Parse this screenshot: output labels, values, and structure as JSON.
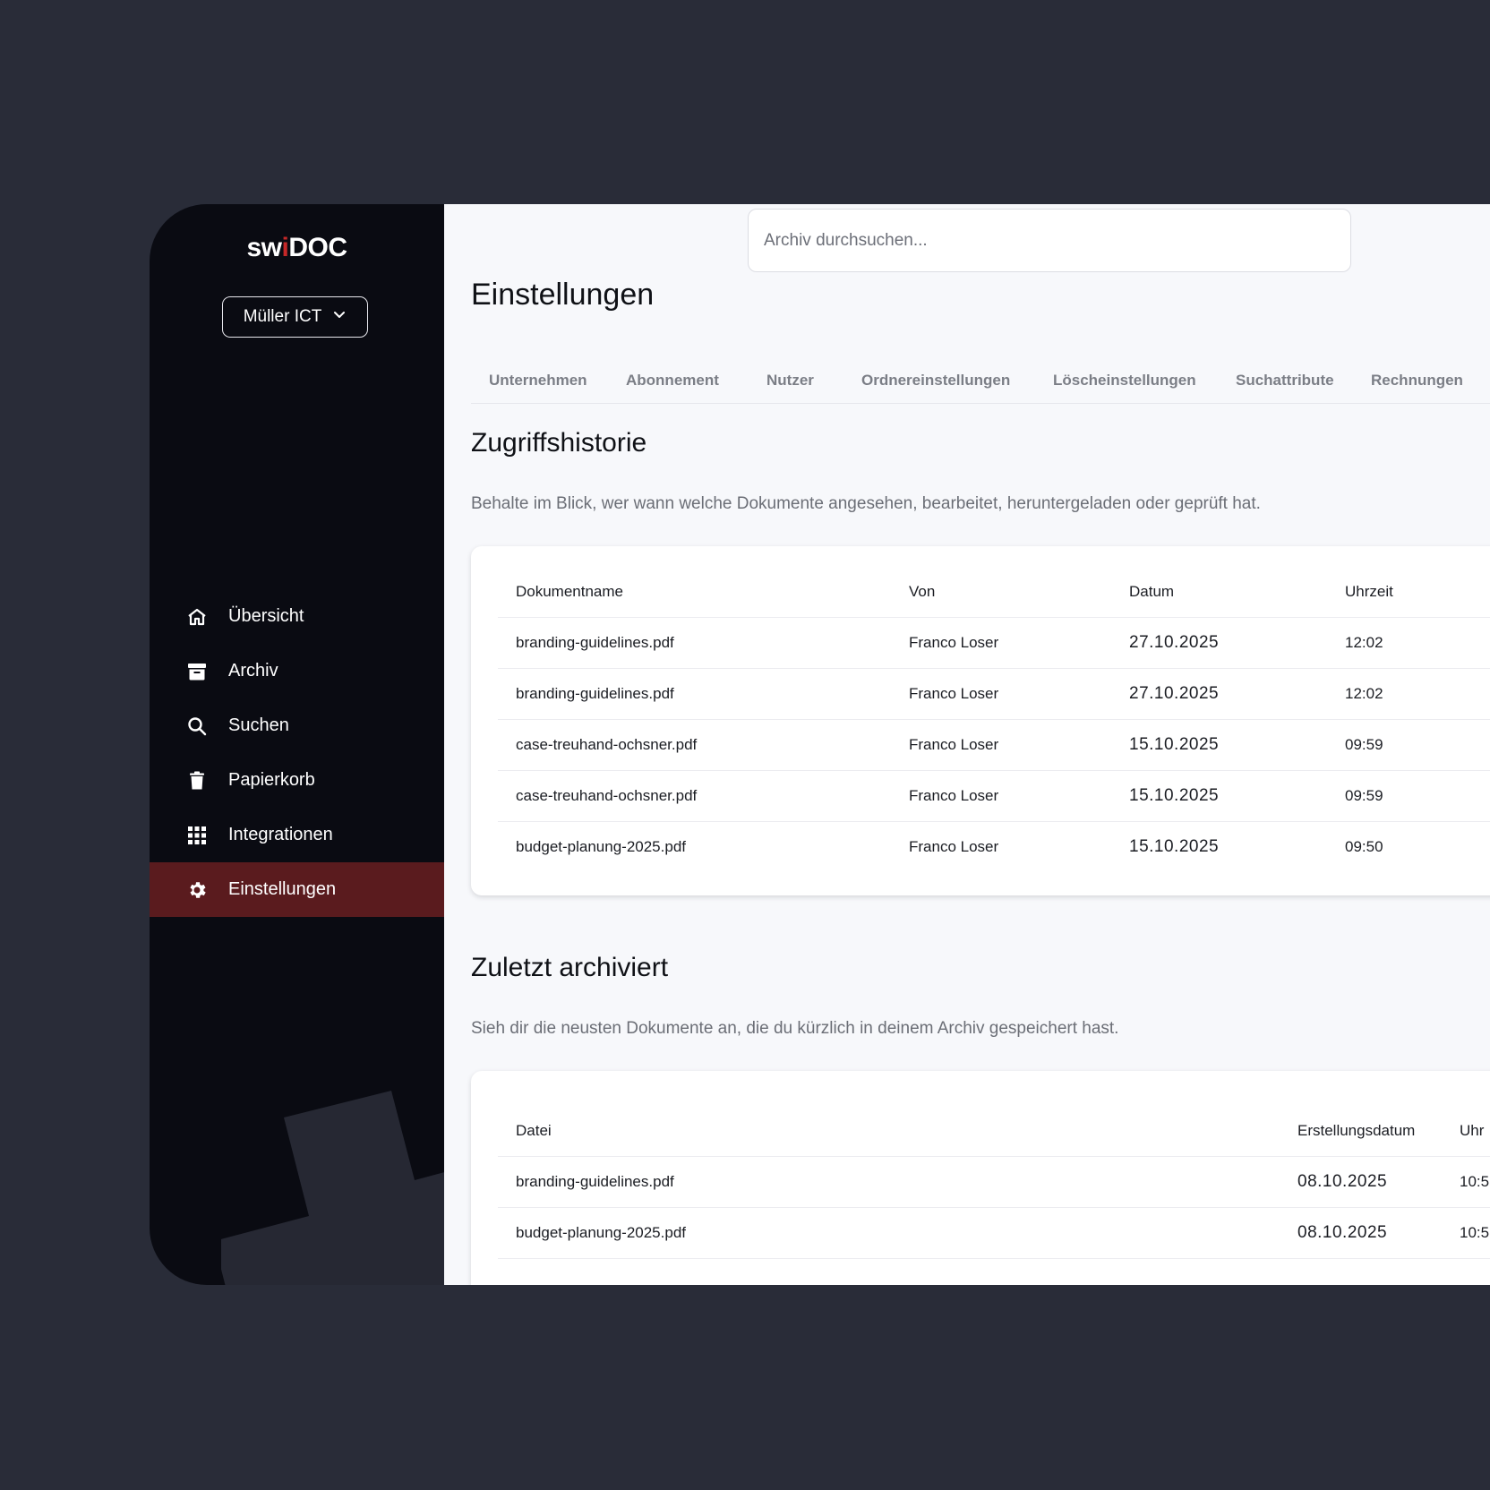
{
  "brand": {
    "name_pre": "sw",
    "name_i": "i",
    "name_post": "DOC",
    "accent": "#c62828"
  },
  "company": {
    "label": "Müller ICT"
  },
  "nav": [
    {
      "label": "Übersicht",
      "icon": "home-icon"
    },
    {
      "label": "Archiv",
      "icon": "archive-icon"
    },
    {
      "label": "Suchen",
      "icon": "search-icon"
    },
    {
      "label": "Papierkorb",
      "icon": "trash-icon"
    },
    {
      "label": "Integrationen",
      "icon": "grid-icon"
    },
    {
      "label": "Einstellungen",
      "icon": "gear-icon",
      "active": true
    }
  ],
  "search": {
    "placeholder": "Archiv durchsuchen..."
  },
  "page": {
    "title": "Einstellungen"
  },
  "tabs": [
    "Unternehmen",
    "Abonnement",
    "Nutzer",
    "Ordnereinstellungen",
    "Löscheinstellungen",
    "Suchattribute",
    "Rechnungen"
  ],
  "access_history": {
    "title": "Zugriffshistorie",
    "description": "Behalte im Blick, wer wann welche Dokumente angesehen, bearbeitet, heruntergeladen oder geprüft hat.",
    "columns": [
      "Dokumentname",
      "Von",
      "Datum",
      "Uhrzeit"
    ],
    "rows": [
      [
        "branding-guidelines.pdf",
        "Franco Loser",
        "27.10.2025",
        "12:02"
      ],
      [
        "branding-guidelines.pdf",
        "Franco Loser",
        "27.10.2025",
        "12:02"
      ],
      [
        "case-treuhand-ochsner.pdf",
        "Franco Loser",
        "15.10.2025",
        "09:59"
      ],
      [
        "case-treuhand-ochsner.pdf",
        "Franco Loser",
        "15.10.2025",
        "09:59"
      ],
      [
        "budget-planung-2025.pdf",
        "Franco Loser",
        "15.10.2025",
        "09:50"
      ]
    ]
  },
  "recent": {
    "title": "Zuletzt archiviert",
    "description": "Sieh dir die neusten Dokumente an, die du kürzlich in deinem Archiv gespeichert hast.",
    "columns": [
      "Datei",
      "Erstellungsdatum",
      "Uhr"
    ],
    "rows": [
      [
        "branding-guidelines.pdf",
        "08.10.2025",
        "10:5"
      ],
      [
        "budget-planung-2025.pdf",
        "08.10.2025",
        "10:5"
      ]
    ]
  }
}
